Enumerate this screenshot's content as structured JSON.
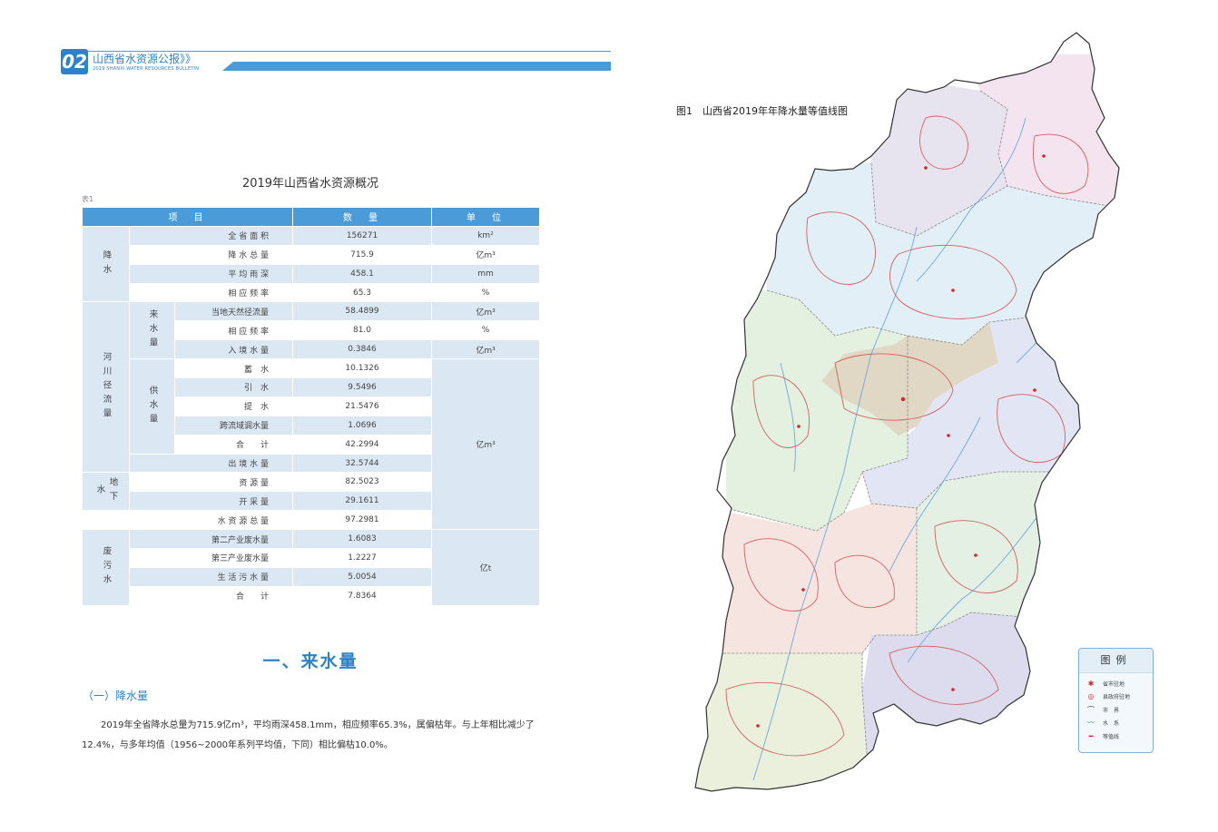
{
  "header": {
    "number": "02",
    "title": "山西省水资源公报》》",
    "subtitle": "2019 SHANXI WATER RESOURCES BULLETIN"
  },
  "table": {
    "title": "2019年山西省水资源概况",
    "label": "表1",
    "headers": [
      "项　目",
      "数　量",
      "单　位"
    ],
    "groups": {
      "precip": "降水",
      "river": "河川径流量",
      "incoming": "来水量",
      "supply": "供水量",
      "groundwater": "地下水",
      "wastewater": "废污水"
    },
    "rows": [
      {
        "item": "全 省 面 积",
        "value": "156271",
        "unit": "km²"
      },
      {
        "item": "降 水 总 量",
        "value": "715.9",
        "unit": "亿m³"
      },
      {
        "item": "平 均 雨 深",
        "value": "458.1",
        "unit": "mm"
      },
      {
        "item": "相 应 频 率",
        "value": "65.3",
        "unit": "%"
      },
      {
        "item": "当地天然径流量",
        "value": "58.4899",
        "unit": "亿m³"
      },
      {
        "item": "相 应 频 率",
        "value": "81.0",
        "unit": "%"
      },
      {
        "item": "入 境 水 量",
        "value": "0.3846",
        "unit": "亿m³"
      },
      {
        "item": "蓄　水",
        "value": "10.1326"
      },
      {
        "item": "引　水",
        "value": "9.5496"
      },
      {
        "item": "提　水",
        "value": "21.5476"
      },
      {
        "item": "跨流域调水量",
        "value": "1.0696"
      },
      {
        "item": "合　　计",
        "value": "42.2994"
      },
      {
        "item": "出 境 水 量",
        "value": "32.5744"
      },
      {
        "item": "资 源 量",
        "value": "82.5023"
      },
      {
        "item": "开 采 量",
        "value": "29.1611"
      },
      {
        "item": "水 资 源 总 量",
        "value": "97.2981"
      },
      {
        "item": "第二产业废水量",
        "value": "1.6083"
      },
      {
        "item": "第三产业废水量",
        "value": "1.2227"
      },
      {
        "item": "生 活 污 水 量",
        "value": "5.0054"
      },
      {
        "item": "合　　计",
        "value": "7.8364"
      }
    ],
    "merged_units": {
      "water": "亿m³",
      "waste": "亿t"
    }
  },
  "section": {
    "heading": "一、来水量",
    "subheading": "（一）降水量",
    "paragraph": "2019年全省降水总量为715.9亿m³，平均雨深458.1mm，相应频率65.3%，属偏枯年。与上年相比减少了12.4%，与多年均值（1956~2000年系列平均值，下同）相比偏枯10.0%。"
  },
  "map": {
    "title": "图1　山西省2019年年降水量等值线图",
    "region_colors": [
      "#f3e4f0",
      "#e8e4ef",
      "#e3eff6",
      "#e4f0e0",
      "#e0d8c4",
      "#e2e6f4",
      "#f6e4e0",
      "#e4f0e4",
      "#dcdcee",
      "#eaf0dc"
    ],
    "legend": {
      "title": "图例",
      "items": [
        {
          "symbol": "✱",
          "label": "省市驻地",
          "color": "#d22"
        },
        {
          "symbol": "◎",
          "label": "县政府驻地",
          "color": "#d22"
        },
        {
          "symbol": "⌒",
          "label": "市　界",
          "color": "#333"
        },
        {
          "symbol": "〰",
          "label": "水　系",
          "color": "#2f82c7"
        },
        {
          "symbol": "━",
          "label": "等值线",
          "color": "#d22"
        }
      ]
    }
  }
}
